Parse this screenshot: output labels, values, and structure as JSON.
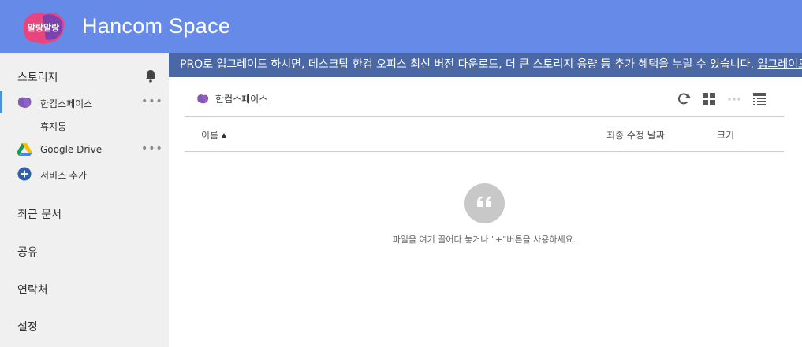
{
  "header": {
    "logo_text": "말랑말랑",
    "title": "Hancom Space",
    "bg_color": "#658ae8"
  },
  "sidebar": {
    "storage_label": "스토리지",
    "items": [
      {
        "label": "한컴스페이스",
        "more": "•••",
        "icon": "hancom-space-icon"
      },
      {
        "label": "휴지통"
      },
      {
        "label": "Google Drive",
        "more": "•••",
        "icon": "google-drive-icon"
      },
      {
        "label": "서비스 추가",
        "icon": "plus-circle-icon"
      }
    ],
    "categories": [
      {
        "label": "최근 문서"
      },
      {
        "label": "공유"
      },
      {
        "label": "연락처"
      },
      {
        "label": "설정"
      }
    ]
  },
  "promo": {
    "text": "PRO로 업그레이드 하시면, 데스크탑 한컴 오피스 최신 버전 다운로드, 더 큰 스토리지 용량 등 추가 혜택을 누릴 수 있습니다. ",
    "link": "업그레이드"
  },
  "main": {
    "breadcrumb": "한컴스페이스",
    "columns": {
      "name": "이름",
      "sort_indicator": "▲",
      "modified": "최종 수정 날짜",
      "size": "크기"
    },
    "empty_message": "파일을 여기 끌어다 놓거나 \"+\"버튼을 사용하세요.",
    "empty_icon": "quote-icon"
  },
  "colors": {
    "promo_bg": "#4a67a6",
    "sidebar_bg": "#f0f0f0",
    "accent": "#4a90e2"
  }
}
